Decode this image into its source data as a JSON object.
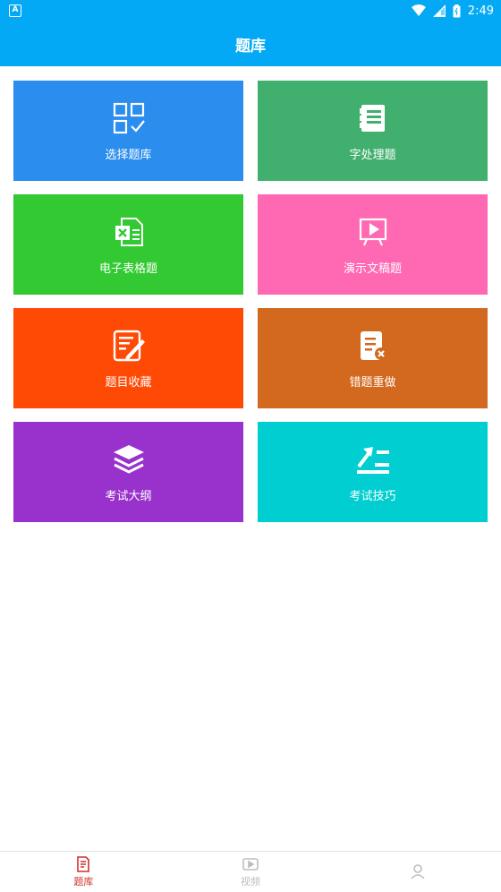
{
  "status_bar": {
    "time": "2:49",
    "app_icon_letter": "A",
    "icons": [
      "wifi-icon",
      "signal-icon",
      "battery-icon"
    ]
  },
  "app_bar": {
    "title": "题库"
  },
  "tiles": [
    {
      "label": "选择题库",
      "color": "#2b8ded",
      "icon": "grid-check-icon"
    },
    {
      "label": "字处理题",
      "color": "#41b06f",
      "icon": "word-doc-icon"
    },
    {
      "label": "电子表格题",
      "color": "#32c932",
      "icon": "excel-icon"
    },
    {
      "label": "演示文稿题",
      "color": "#ff69b4",
      "icon": "presentation-icon"
    },
    {
      "label": "题目收藏",
      "color": "#ff4a05",
      "icon": "edit-note-icon"
    },
    {
      "label": "错题重做",
      "color": "#d2691e",
      "icon": "wrong-doc-icon"
    },
    {
      "label": "考试大纲",
      "color": "#9932cc",
      "icon": "layers-icon"
    },
    {
      "label": "考试技巧",
      "color": "#00ced1",
      "icon": "trend-list-icon"
    }
  ],
  "bottom_nav": {
    "items": [
      {
        "label": "题库",
        "icon": "question-bank-icon",
        "active": true
      },
      {
        "label": "视频",
        "icon": "video-icon",
        "active": false
      },
      {
        "label": "",
        "icon": "profile-icon",
        "active": false
      }
    ],
    "active_color": "#d32f2f",
    "inactive_color": "#bdbdbd"
  }
}
